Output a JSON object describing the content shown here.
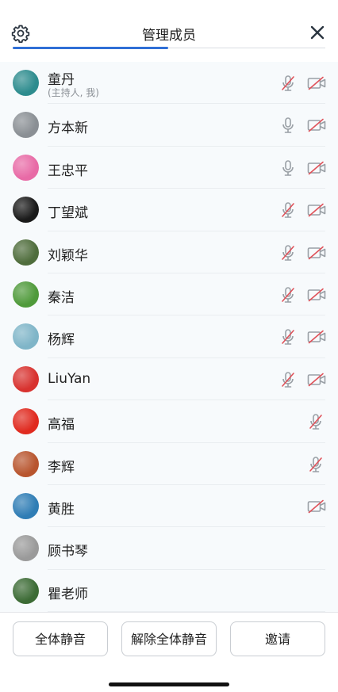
{
  "header": {
    "title": "管理成员"
  },
  "members": [
    {
      "name": "童丹",
      "subtitle": "(主持人, 我)",
      "mic_muted": true,
      "show_mic": true,
      "cam_off": true,
      "show_cam": true,
      "avatar_color": "#2d8c8e"
    },
    {
      "name": "方本新",
      "subtitle": "",
      "mic_muted": false,
      "show_mic": true,
      "cam_off": true,
      "show_cam": true,
      "avatar_color": "#8a8f94"
    },
    {
      "name": "王忠平",
      "subtitle": "",
      "mic_muted": false,
      "show_mic": true,
      "cam_off": true,
      "show_cam": true,
      "avatar_color": "#e86aa6"
    },
    {
      "name": "丁望斌",
      "subtitle": "",
      "mic_muted": true,
      "show_mic": true,
      "cam_off": true,
      "show_cam": true,
      "avatar_color": "#1a1a1a"
    },
    {
      "name": "刘颖华",
      "subtitle": "",
      "mic_muted": true,
      "show_mic": true,
      "cam_off": true,
      "show_cam": true,
      "avatar_color": "#4f6d3c"
    },
    {
      "name": "秦洁",
      "subtitle": "",
      "mic_muted": true,
      "show_mic": true,
      "cam_off": true,
      "show_cam": true,
      "avatar_color": "#4f9a3a"
    },
    {
      "name": "杨辉",
      "subtitle": "",
      "mic_muted": true,
      "show_mic": true,
      "cam_off": true,
      "show_cam": true,
      "avatar_color": "#7fb5c8"
    },
    {
      "name": "LiuYan",
      "subtitle": "",
      "mic_muted": true,
      "show_mic": true,
      "cam_off": true,
      "show_cam": true,
      "avatar_color": "#d8322f"
    },
    {
      "name": "高福",
      "subtitle": "",
      "mic_muted": true,
      "show_mic": true,
      "cam_off": false,
      "show_cam": false,
      "avatar_color": "#e02a1f"
    },
    {
      "name": "李辉",
      "subtitle": "",
      "mic_muted": true,
      "show_mic": true,
      "cam_off": false,
      "show_cam": false,
      "avatar_color": "#b8552e"
    },
    {
      "name": "黄胜",
      "subtitle": "",
      "mic_muted": false,
      "show_mic": false,
      "cam_off": true,
      "show_cam": true,
      "avatar_color": "#2f7db5"
    },
    {
      "name": "顾书琴",
      "subtitle": "",
      "mic_muted": false,
      "show_mic": false,
      "cam_off": false,
      "show_cam": false,
      "avatar_color": "#9a9a9a"
    },
    {
      "name": "瞿老师",
      "subtitle": "",
      "mic_muted": false,
      "show_mic": false,
      "cam_off": false,
      "show_cam": false,
      "avatar_color": "#3c6b35"
    }
  ],
  "footer": {
    "mute_all_label": "全体静音",
    "unmute_all_label": "解除全体静音",
    "invite_label": "邀请"
  },
  "colors": {
    "accent": "#2f6fd6",
    "muted_red": "#e0525a",
    "icon_gray": "#9aa0a6"
  },
  "icons": {
    "settings": "gear-icon",
    "close": "close-icon",
    "mic": "microphone-icon",
    "mic_muted": "microphone-muted-icon",
    "camera_off": "camera-off-icon"
  }
}
